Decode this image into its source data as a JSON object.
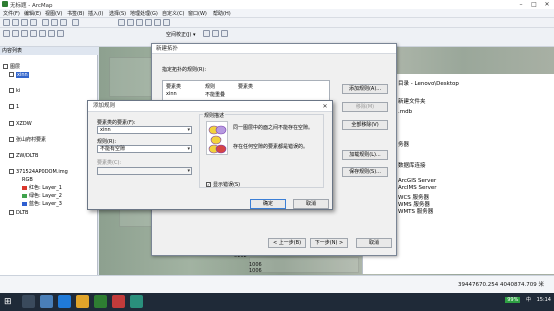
{
  "app": {
    "title": "无标题 - ArcMap"
  },
  "menu": [
    "文件(F)",
    "编辑(E)",
    "视图(V)",
    "书签(B)",
    "插入(I)",
    "选择(S)",
    "地理处理(G)",
    "自定义(C)",
    "窗口(W)",
    "帮助(H)"
  ],
  "toolbar": {
    "scale": "1:11,100",
    "spatial_correction": "空间校正(J) ▾"
  },
  "toc": {
    "header": "内容列表",
    "items": [
      {
        "label": "图层",
        "level": 0
      },
      {
        "label": "xinn",
        "level": 1,
        "selected": true
      },
      {
        "label": "ki",
        "level": 1
      },
      {
        "label": "1",
        "level": 1
      },
      {
        "label": "XZDW",
        "level": 1
      },
      {
        "label": "张山府村要素",
        "level": 1
      },
      {
        "label": "ZW/DLTB",
        "level": 1
      },
      {
        "label": "371524AP0DOM.img",
        "level": 1
      },
      {
        "label": "RGB",
        "level": 2
      },
      {
        "label": "红色: Layer_1",
        "level": 2,
        "color": "#d9362b"
      },
      {
        "label": "绿色: Layer_2",
        "level": 2,
        "color": "#3fa34d"
      },
      {
        "label": "蓝色: Layer_3",
        "level": 2,
        "color": "#2f5fd1"
      },
      {
        "label": "DLTB",
        "level": 1
      }
    ]
  },
  "catalog": {
    "items": [
      "目录 - Lenovo\\Desktop",
      "新建文件夹",
      ".mdb",
      "务器",
      "数据库连接",
      "ArcGIS Server",
      "ArcIMS Server",
      "WCS 服务器",
      "WMS 服务器",
      "WMTS 服务器"
    ]
  },
  "map_labels": [
    "0102",
    "1006",
    "1006",
    "1102"
  ],
  "status": {
    "coords": "39447670.254  4040874.709 米"
  },
  "taskbar": {
    "time": "15:14",
    "lang": "中",
    "battery": "99%"
  },
  "wizard": {
    "title": "新建拓扑",
    "prompt": "指定拓扑的规则(R):",
    "columns": [
      "要素类",
      "规则",
      "要素类"
    ],
    "row": [
      "xinn",
      "不能重叠",
      ""
    ],
    "buttons": {
      "add": "添加规则(A)...",
      "remove": "移除(M)",
      "remove_all": "全部移除(V)",
      "load": "加载规则(L)...",
      "save": "保存规则(S)...",
      "prev": "< 上一步(B)",
      "next": "下一步(N) >",
      "cancel": "取消"
    }
  },
  "add_rule": {
    "title": "添加规则",
    "feature_label": "要素类的要素(F):",
    "feature_value": "xinn",
    "rule_label": "规则(R):",
    "rule_value": "不能有空隙",
    "class_label": "要素类(C):",
    "class_value": "",
    "desc_heading": "规则描述",
    "desc_line1": "同一图层中的面之间不能存在空隙。",
    "desc_line2": "存在任何空隙的要素都是错误的。",
    "show_errors": "显示错误(S)",
    "ok": "确定",
    "cancel": "取消"
  }
}
